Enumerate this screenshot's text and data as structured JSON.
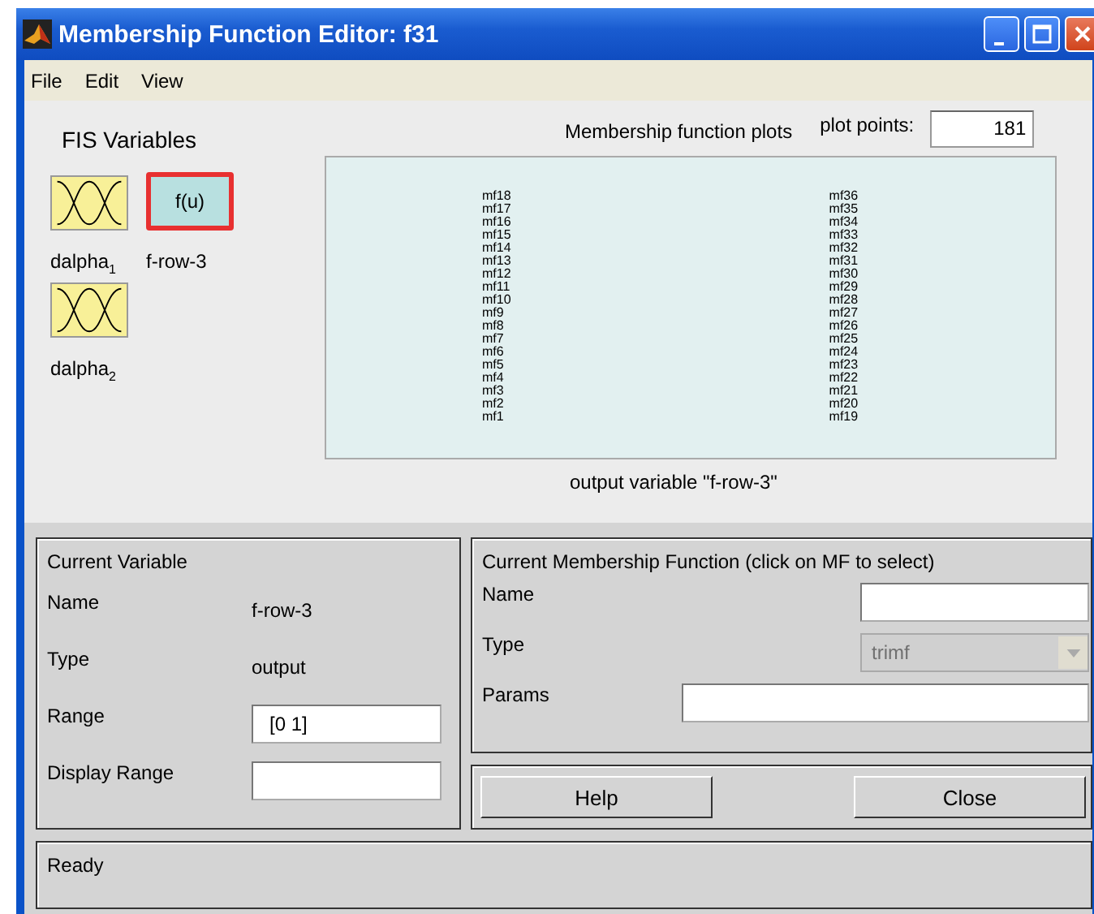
{
  "window": {
    "title": "Membership Function Editor: f31"
  },
  "menu": [
    "File",
    "Edit",
    "View"
  ],
  "fis_variables": {
    "title": "FIS Variables",
    "items": [
      {
        "kind": "input",
        "label": "dalpha$_{1}$",
        "selected": false
      },
      {
        "kind": "output",
        "icon_text": "f(u)",
        "label": "f-row-3",
        "selected": true
      },
      {
        "kind": "input",
        "label": "dalpha$_{2}$",
        "selected": false
      }
    ]
  },
  "plot": {
    "title": "Membership function plots",
    "plot_points_label": "plot points:",
    "plot_points": "181",
    "caption": "output variable \"f-row-3\"",
    "label_columns": [
      [
        "mf18",
        "mf17",
        "mf16",
        "mf15",
        "mf14",
        "mf13",
        "mf12",
        "mf11",
        "mf10",
        "mf9",
        "mf8",
        "mf7",
        "mf6",
        "mf5",
        "mf4",
        "mf3",
        "mf2",
        "mf1"
      ],
      [
        "mf36",
        "mf35",
        "mf34",
        "mf33",
        "mf32",
        "mf31",
        "mf30",
        "mf29",
        "mf28",
        "mf27",
        "mf26",
        "mf25",
        "mf24",
        "mf23",
        "mf22",
        "mf21",
        "mf20",
        "mf19"
      ]
    ]
  },
  "current_variable": {
    "title": "Current Variable",
    "rows": [
      {
        "kind": "text",
        "label": "Name",
        "value": "f-row-3"
      },
      {
        "kind": "text",
        "label": "Type",
        "value": "output"
      },
      {
        "kind": "field",
        "label": "Range",
        "value": "[0 1]"
      },
      {
        "kind": "field",
        "label": "Display Range"
      }
    ]
  },
  "current_mf": {
    "title": "Current Membership Function (click on MF to select)",
    "rows": [
      {
        "kind": "field",
        "label": "Name"
      },
      {
        "kind": "dropdown",
        "label": "Type",
        "value": "trimf",
        "disabled": true
      },
      {
        "kind": "wide_field",
        "label": "Params"
      }
    ]
  },
  "buttons": [
    "Help",
    "Close"
  ],
  "status_bar": "Ready"
}
